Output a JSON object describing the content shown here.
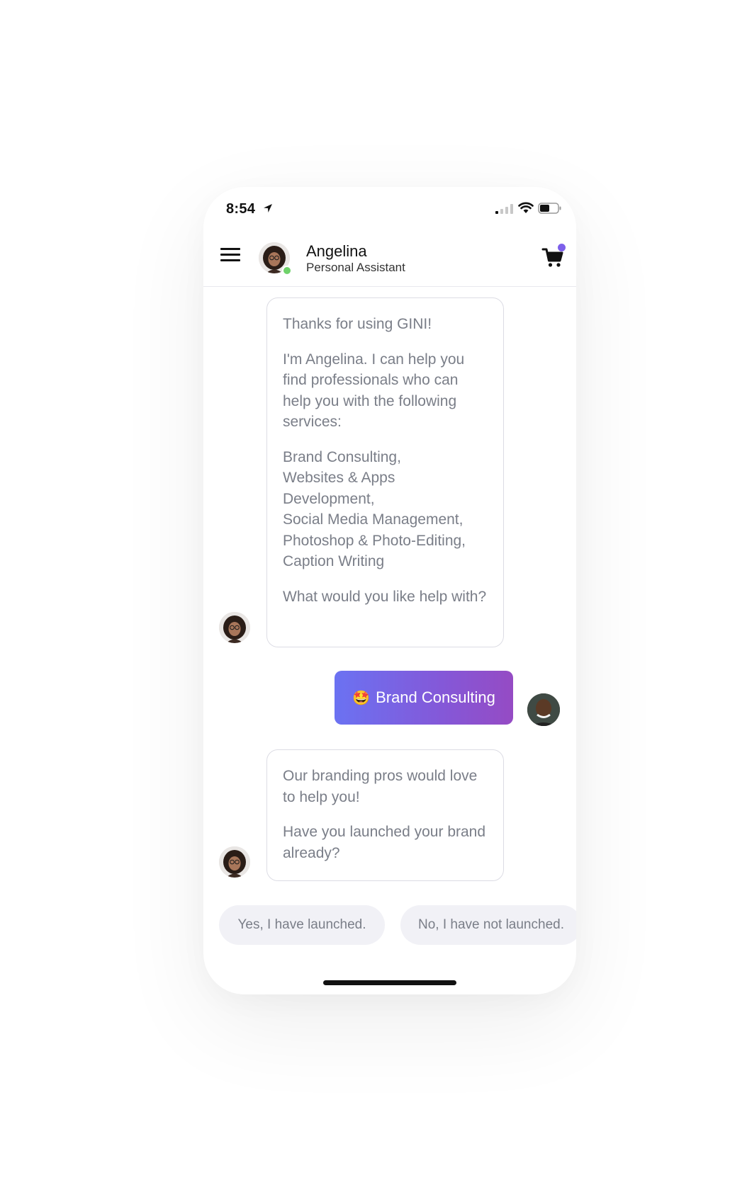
{
  "status_bar": {
    "time": "8:54"
  },
  "header": {
    "agent_name": "Angelina",
    "agent_role": "Personal Assistant",
    "menu_icon": "hamburger-menu-icon",
    "cart_icon": "shopping-cart-icon",
    "online_status_color": "#6fd26a",
    "cart_badge_color": "#7d60ea"
  },
  "messages": [
    {
      "sender": "bot",
      "paragraphs": [
        "Thanks for using GINI!",
        "I'm Angelina. I can help you find professionals who can help you with the following services:",
        "Brand Consulting,\nWebsites & Apps Development,\nSocial Media Management,\nPhotoshop & Photo-Editing,\nCaption Writing",
        "What would you like help with?"
      ]
    },
    {
      "sender": "user",
      "emoji": "🤩",
      "text": "Brand Consulting"
    },
    {
      "sender": "bot",
      "paragraphs": [
        "Our branding pros would love to help you!",
        "Have you launched your brand already?"
      ]
    }
  ],
  "quick_replies": [
    "Yes, I have launched.",
    "No, I have not launched."
  ],
  "colors": {
    "accent_gradient_start": "#6b72f2",
    "accent_gradient_end": "#954bc4",
    "bubble_text": "#7a7e88",
    "bubble_border": "#dcdce4",
    "chip_background": "#f1f1f6"
  }
}
